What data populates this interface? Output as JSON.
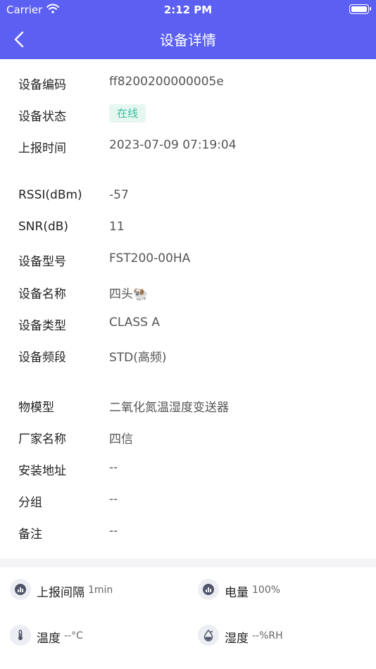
{
  "status_bar": {
    "carrier": "Carrier",
    "time": "2:12 PM"
  },
  "nav": {
    "title": "设备详情"
  },
  "device_info": {
    "code": {
      "label": "设备编码",
      "value": "ff8200200000005e"
    },
    "status": {
      "label": "设备状态",
      "value": "在线",
      "color": "#3bbd9b"
    },
    "report_time": {
      "label": "上报时间",
      "value": "2023-07-09 07:19:04"
    },
    "rssi": {
      "label": "RSSI(dBm)",
      "value": "-57"
    },
    "snr": {
      "label": "SNR(dB)",
      "value": "11"
    },
    "model": {
      "label": "设备型号",
      "value": "FST200-00HA"
    },
    "name": {
      "label": "设备名称",
      "value": "四头🐏"
    },
    "type": {
      "label": "设备类型",
      "value": "CLASS A"
    },
    "band": {
      "label": "设备频段",
      "value": "STD(高频)"
    },
    "thing_model": {
      "label": "物模型",
      "value": "二氧化氮温湿度变送器"
    },
    "vendor": {
      "label": "厂家名称",
      "value": "四信"
    },
    "address": {
      "label": "安装地址",
      "value": "--"
    },
    "group": {
      "label": "分组",
      "value": "--"
    },
    "remark": {
      "label": "备注",
      "value": "--"
    }
  },
  "stats": {
    "interval": {
      "label": "上报间隔",
      "value": "1min",
      "icon": "bar-chart-icon"
    },
    "battery": {
      "label": "电量",
      "value": "100%",
      "icon": "bar-chart-icon"
    },
    "temperature": {
      "label": "温度",
      "value": "--°C",
      "icon": "thermometer-icon"
    },
    "humidity": {
      "label": "湿度",
      "value": "--%RH",
      "icon": "water-drop-icon"
    }
  },
  "colors": {
    "primary": "#5b5ff2",
    "online_badge_bg": "#e6f7f2"
  }
}
